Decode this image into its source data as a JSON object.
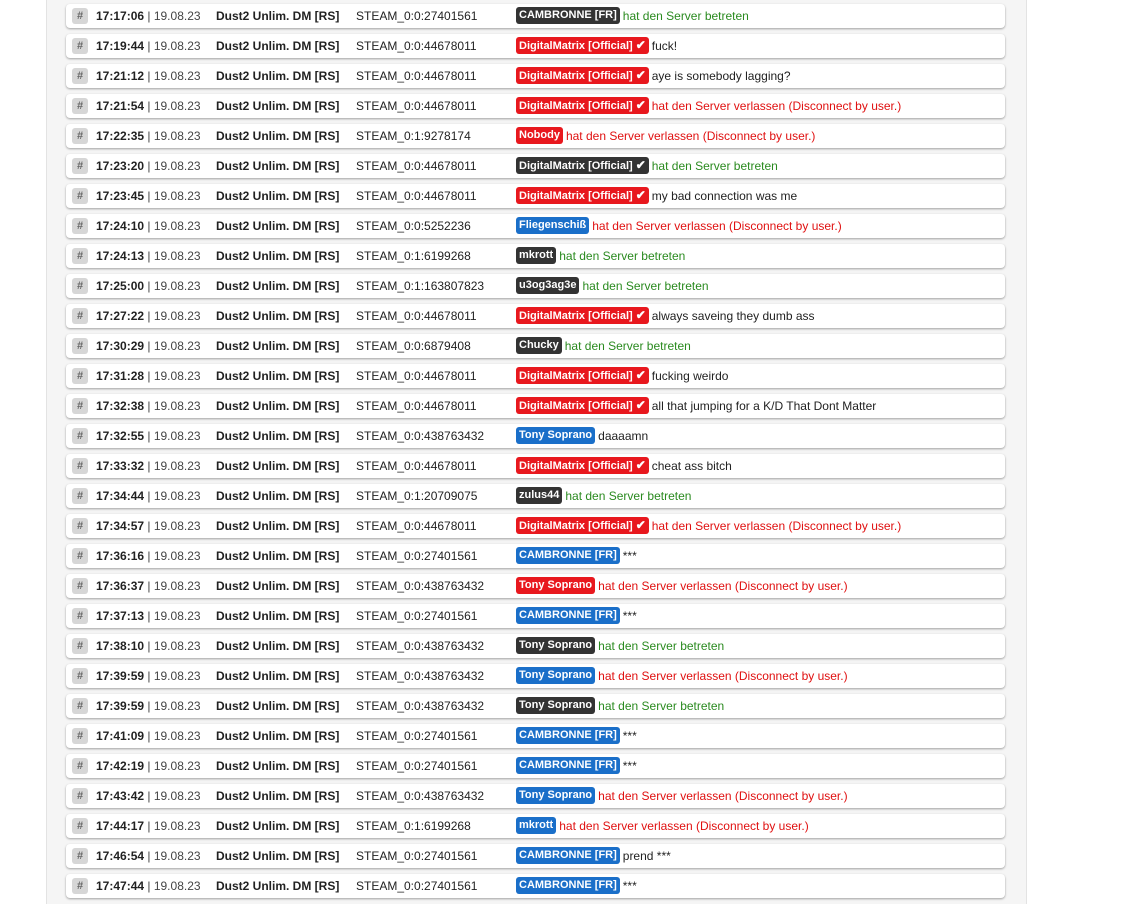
{
  "hash_icon": "#",
  "colors": {
    "red": "#e8181e",
    "dark": "#333333",
    "blue": "#1a6fc9",
    "join": "#2a8a1f",
    "leave": "#e01010"
  },
  "rows": [
    {
      "time": "17:17:06",
      "date": "19.08.23",
      "server": "Dust2 Unlim. DM [RS]",
      "steam": "STEAM_0:0:27401561",
      "player": "CAMBRONNE [FR]",
      "color": "dark",
      "verified": false,
      "message": "hat den Server betreten",
      "type": "join"
    },
    {
      "time": "17:19:44",
      "date": "19.08.23",
      "server": "Dust2 Unlim. DM [RS]",
      "steam": "STEAM_0:0:44678011",
      "player": "DigitalMatrix [Official]",
      "color": "red",
      "verified": true,
      "message": "fuck!",
      "type": "chat"
    },
    {
      "time": "17:21:12",
      "date": "19.08.23",
      "server": "Dust2 Unlim. DM [RS]",
      "steam": "STEAM_0:0:44678011",
      "player": "DigitalMatrix [Official]",
      "color": "red",
      "verified": true,
      "message": "aye is somebody lagging?",
      "type": "chat"
    },
    {
      "time": "17:21:54",
      "date": "19.08.23",
      "server": "Dust2 Unlim. DM [RS]",
      "steam": "STEAM_0:0:44678011",
      "player": "DigitalMatrix [Official]",
      "color": "red",
      "verified": true,
      "message": "hat den Server verlassen (Disconnect by user.)",
      "type": "leave"
    },
    {
      "time": "17:22:35",
      "date": "19.08.23",
      "server": "Dust2 Unlim. DM [RS]",
      "steam": "STEAM_0:1:9278174",
      "player": "Nobody",
      "color": "red",
      "verified": false,
      "message": "hat den Server verlassen (Disconnect by user.)",
      "type": "leave"
    },
    {
      "time": "17:23:20",
      "date": "19.08.23",
      "server": "Dust2 Unlim. DM [RS]",
      "steam": "STEAM_0:0:44678011",
      "player": "DigitalMatrix [Official]",
      "color": "dark",
      "verified": true,
      "message": "hat den Server betreten",
      "type": "join"
    },
    {
      "time": "17:23:45",
      "date": "19.08.23",
      "server": "Dust2 Unlim. DM [RS]",
      "steam": "STEAM_0:0:44678011",
      "player": "DigitalMatrix [Official]",
      "color": "red",
      "verified": true,
      "message": "my bad connection was me",
      "type": "chat"
    },
    {
      "time": "17:24:10",
      "date": "19.08.23",
      "server": "Dust2 Unlim. DM [RS]",
      "steam": "STEAM_0:0:5252236",
      "player": "Fliegenschiß",
      "color": "blue",
      "verified": false,
      "message": "hat den Server verlassen (Disconnect by user.)",
      "type": "leave"
    },
    {
      "time": "17:24:13",
      "date": "19.08.23",
      "server": "Dust2 Unlim. DM [RS]",
      "steam": "STEAM_0:1:6199268",
      "player": "mkrott",
      "color": "dark",
      "verified": false,
      "message": "hat den Server betreten",
      "type": "join"
    },
    {
      "time": "17:25:00",
      "date": "19.08.23",
      "server": "Dust2 Unlim. DM [RS]",
      "steam": "STEAM_0:1:163807823",
      "player": "u3og3ag3e",
      "color": "dark",
      "verified": false,
      "message": "hat den Server betreten",
      "type": "join"
    },
    {
      "time": "17:27:22",
      "date": "19.08.23",
      "server": "Dust2 Unlim. DM [RS]",
      "steam": "STEAM_0:0:44678011",
      "player": "DigitalMatrix [Official]",
      "color": "red",
      "verified": true,
      "message": "always saveing they dumb ass",
      "type": "chat"
    },
    {
      "time": "17:30:29",
      "date": "19.08.23",
      "server": "Dust2 Unlim. DM [RS]",
      "steam": "STEAM_0:0:6879408",
      "player": "Chucky",
      "color": "dark",
      "verified": false,
      "message": "hat den Server betreten",
      "type": "join"
    },
    {
      "time": "17:31:28",
      "date": "19.08.23",
      "server": "Dust2 Unlim. DM [RS]",
      "steam": "STEAM_0:0:44678011",
      "player": "DigitalMatrix [Official]",
      "color": "red",
      "verified": true,
      "message": "fucking weirdo",
      "type": "chat"
    },
    {
      "time": "17:32:38",
      "date": "19.08.23",
      "server": "Dust2 Unlim. DM [RS]",
      "steam": "STEAM_0:0:44678011",
      "player": "DigitalMatrix [Official]",
      "color": "red",
      "verified": true,
      "message": "all that jumping for a K/D That Dont Matter",
      "type": "chat"
    },
    {
      "time": "17:32:55",
      "date": "19.08.23",
      "server": "Dust2 Unlim. DM [RS]",
      "steam": "STEAM_0:0:438763432",
      "player": "Tony Soprano",
      "color": "blue",
      "verified": false,
      "message": "daaaamn",
      "type": "chat"
    },
    {
      "time": "17:33:32",
      "date": "19.08.23",
      "server": "Dust2 Unlim. DM [RS]",
      "steam": "STEAM_0:0:44678011",
      "player": "DigitalMatrix [Official]",
      "color": "red",
      "verified": true,
      "message": "cheat ass bitch",
      "type": "chat"
    },
    {
      "time": "17:34:44",
      "date": "19.08.23",
      "server": "Dust2 Unlim. DM [RS]",
      "steam": "STEAM_0:1:20709075",
      "player": "zulus44",
      "color": "dark",
      "verified": false,
      "message": "hat den Server betreten",
      "type": "join"
    },
    {
      "time": "17:34:57",
      "date": "19.08.23",
      "server": "Dust2 Unlim. DM [RS]",
      "steam": "STEAM_0:0:44678011",
      "player": "DigitalMatrix [Official]",
      "color": "red",
      "verified": true,
      "message": "hat den Server verlassen (Disconnect by user.)",
      "type": "leave"
    },
    {
      "time": "17:36:16",
      "date": "19.08.23",
      "server": "Dust2 Unlim. DM [RS]",
      "steam": "STEAM_0:0:27401561",
      "player": "CAMBRONNE [FR]",
      "color": "blue",
      "verified": false,
      "message": "***",
      "type": "chat"
    },
    {
      "time": "17:36:37",
      "date": "19.08.23",
      "server": "Dust2 Unlim. DM [RS]",
      "steam": "STEAM_0:0:438763432",
      "player": "Tony Soprano",
      "color": "red",
      "verified": false,
      "message": "hat den Server verlassen (Disconnect by user.)",
      "type": "leave"
    },
    {
      "time": "17:37:13",
      "date": "19.08.23",
      "server": "Dust2 Unlim. DM [RS]",
      "steam": "STEAM_0:0:27401561",
      "player": "CAMBRONNE [FR]",
      "color": "blue",
      "verified": false,
      "message": "***",
      "type": "chat"
    },
    {
      "time": "17:38:10",
      "date": "19.08.23",
      "server": "Dust2 Unlim. DM [RS]",
      "steam": "STEAM_0:0:438763432",
      "player": "Tony Soprano",
      "color": "dark",
      "verified": false,
      "message": "hat den Server betreten",
      "type": "join"
    },
    {
      "time": "17:39:59",
      "date": "19.08.23",
      "server": "Dust2 Unlim. DM [RS]",
      "steam": "STEAM_0:0:438763432",
      "player": "Tony Soprano",
      "color": "blue",
      "verified": false,
      "message": "hat den Server verlassen (Disconnect by user.)",
      "type": "leave"
    },
    {
      "time": "17:39:59",
      "date": "19.08.23",
      "server": "Dust2 Unlim. DM [RS]",
      "steam": "STEAM_0:0:438763432",
      "player": "Tony Soprano",
      "color": "dark",
      "verified": false,
      "message": "hat den Server betreten",
      "type": "join"
    },
    {
      "time": "17:41:09",
      "date": "19.08.23",
      "server": "Dust2 Unlim. DM [RS]",
      "steam": "STEAM_0:0:27401561",
      "player": "CAMBRONNE [FR]",
      "color": "blue",
      "verified": false,
      "message": "***",
      "type": "chat"
    },
    {
      "time": "17:42:19",
      "date": "19.08.23",
      "server": "Dust2 Unlim. DM [RS]",
      "steam": "STEAM_0:0:27401561",
      "player": "CAMBRONNE [FR]",
      "color": "blue",
      "verified": false,
      "message": "***",
      "type": "chat"
    },
    {
      "time": "17:43:42",
      "date": "19.08.23",
      "server": "Dust2 Unlim. DM [RS]",
      "steam": "STEAM_0:0:438763432",
      "player": "Tony Soprano",
      "color": "blue",
      "verified": false,
      "message": "hat den Server verlassen (Disconnect by user.)",
      "type": "leave"
    },
    {
      "time": "17:44:17",
      "date": "19.08.23",
      "server": "Dust2 Unlim. DM [RS]",
      "steam": "STEAM_0:1:6199268",
      "player": "mkrott",
      "color": "blue",
      "verified": false,
      "message": "hat den Server verlassen (Disconnect by user.)",
      "type": "leave"
    },
    {
      "time": "17:46:54",
      "date": "19.08.23",
      "server": "Dust2 Unlim. DM [RS]",
      "steam": "STEAM_0:0:27401561",
      "player": "CAMBRONNE [FR]",
      "color": "blue",
      "verified": false,
      "message": "prend ***",
      "type": "chat"
    },
    {
      "time": "17:47:44",
      "date": "19.08.23",
      "server": "Dust2 Unlim. DM [RS]",
      "steam": "STEAM_0:0:27401561",
      "player": "CAMBRONNE [FR]",
      "color": "blue",
      "verified": false,
      "message": "***",
      "type": "chat"
    }
  ]
}
